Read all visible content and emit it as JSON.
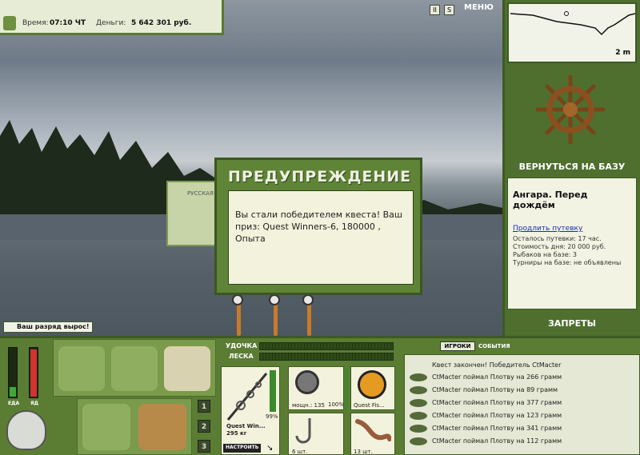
{
  "hud": {
    "time_label": "Время:",
    "time_value": "07:10 ЧТ",
    "money_label": "Деньги:",
    "money_value": "5 642 301 руб.",
    "menu_label": "МЕНЮ",
    "pause_icon": "pause-icon",
    "sound_icon": "sound-icon"
  },
  "minimap": {
    "depth": "2 m"
  },
  "right_panel": {
    "return_label": "ВЕРНУТЬСЯ НА БАЗУ",
    "base_title": "Ангара. Перед дождём",
    "extend_link": "Продлить путевку",
    "lines": [
      "Осталось путевки: 17 час.",
      "Стоимость дня: 20 000 руб.",
      "Рыбаков на базе: 3",
      "Турниры на базе: не объявлены"
    ],
    "bans_label": "ЗАПРЕТЫ"
  },
  "background_window": {
    "label": "РУССКАЯ"
  },
  "dialog": {
    "title": "ПРЕДУПРЕЖДЕНИЕ",
    "message": "Вы стали победителем квеста! Ваш приз: Quest Winners-6, 180000 , Опыта"
  },
  "rank_message": "Ваш разряд вырос!",
  "meters": {
    "food_label": "ЕДА",
    "poison_label": "ЯД",
    "food_level": 0.2,
    "poison_level": 0.95
  },
  "slots": [
    "1",
    "2",
    "3"
  ],
  "tackle": {
    "rod_label": "УДОЧКА",
    "line_label": "ЛЕСКА",
    "rod_name": "Quest Win...",
    "rod_weight": "295 кг",
    "rod_percent": "99%",
    "setup_label": "НАСТРОИТЬ",
    "reel_power": "мощн.: 135",
    "reel_percent": "100%",
    "line_name": "Quest Fis...",
    "hook_count": "6 шт.",
    "bait_count": "13 шт."
  },
  "log": {
    "tab_players": "ИГРОКИ",
    "tab_events": "СОБЫТИЯ",
    "entries": [
      "Квест закончен! Победитель CtMacter",
      "CtMacter поймал Плотву на 266 грамм",
      "CtMacter поймал Плотву на 89 грамм",
      "CtMacter поймал Плотву на 377 грамм",
      "CtMacter поймал Плотву на 123 грамм",
      "CtMacter поймал Плотву на 341 грамм",
      "CtMacter поймал Плотву на 112 грамм"
    ]
  }
}
